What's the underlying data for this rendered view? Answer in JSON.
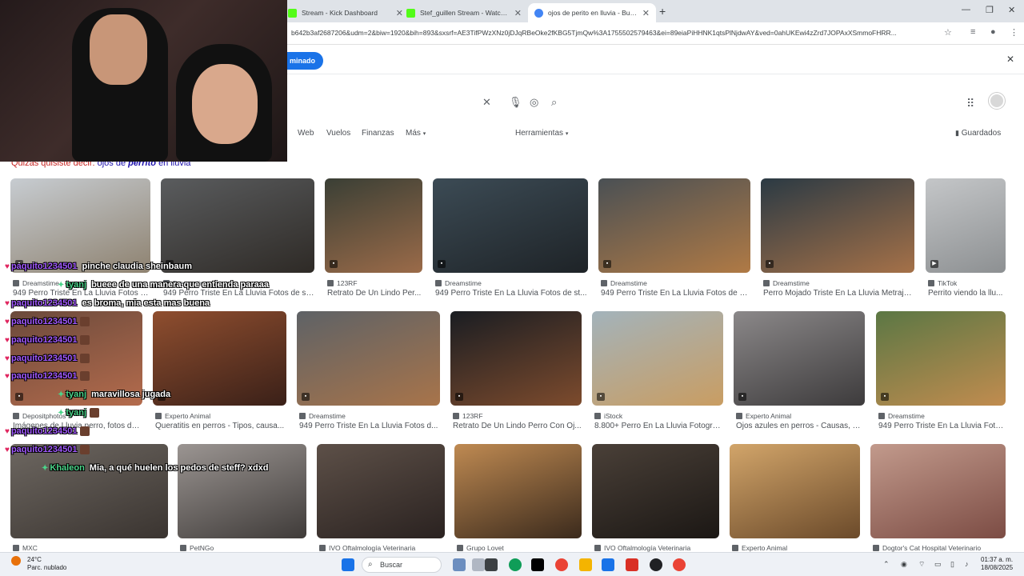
{
  "browser": {
    "tabs": [
      {
        "label": "Stream - Kick Dashboard",
        "color": "#53fc18"
      },
      {
        "label": "Stef_guillen Stream - Watch Li",
        "color": "#53fc18"
      },
      {
        "label": "ojos de perito en lluvia - Busca",
        "color": "#4285f4"
      }
    ],
    "new_tab": "+",
    "url": "b642b3af2687206&udm=2&biw=1920&bih=893&sxsrf=AE3TifPWzXNz0jDJqRBeOke2fKBG5TjmQw%3A1755502579463&ei=89eiaPiHHNK1qtsPlNjdwAY&ved=0ahUKEwi4zZrd7JOPAxXSmmoFHRR...",
    "infobar_pill": "minado"
  },
  "google": {
    "nav_tabs": [
      "Web",
      "Vuelos",
      "Finanzas",
      "Más",
      "Herramientas"
    ],
    "saved_label": "Guardados",
    "did_you_mean": {
      "prefix": "Quizás quisiste decir:",
      "pre": "ojos de",
      "bold": "perrito",
      "post": "en lluvia"
    }
  },
  "results_row1": [
    {
      "source": "Dreamstime",
      "title": "949 Perro Triste En La Lluvia Fotos d...",
      "colors": [
        "#c7ccd1",
        "#8e8270"
      ]
    },
    {
      "source": "Dreamstime",
      "title": "949 Perro Triste En La Lluvia Fotos de st...",
      "colors": [
        "#5a5c5e",
        "#2e2a26"
      ]
    },
    {
      "source": "123RF",
      "title": "Retrato De Un Lindo Per...",
      "colors": [
        "#3a3f35",
        "#9b6b49"
      ]
    },
    {
      "source": "Dreamstime",
      "title": "949 Perro Triste En La Lluvia Fotos de st...",
      "colors": [
        "#3c4b55",
        "#1e2327"
      ]
    },
    {
      "source": "Dreamstime",
      "title": "949 Perro Triste En La Lluvia Fotos de st...",
      "colors": [
        "#4a5054",
        "#b07a45"
      ]
    },
    {
      "source": "Dreamstime",
      "title": "Perro Mojado Triste En La Lluvia Metraje...",
      "colors": [
        "#2b3a44",
        "#a57148"
      ]
    },
    {
      "source": "TikTok",
      "title": "Perrito viendo la llu...",
      "colors": [
        "#c4c6c8",
        "#8d9092"
      ]
    }
  ],
  "results_row2": [
    {
      "source": "Depositphotos",
      "title": "Imágenes de Lluvia perro, fotos de...",
      "colors": [
        "#6b4a3c",
        "#b46b4c"
      ]
    },
    {
      "source": "Experto Animal",
      "title": "Queratitis en perros - Tipos, causa...",
      "colors": [
        "#8f4e2f",
        "#3a2018"
      ]
    },
    {
      "source": "Dreamstime",
      "title": "949 Perro Triste En La Lluvia Fotos d...",
      "colors": [
        "#5e6266",
        "#a8744a"
      ]
    },
    {
      "source": "123RF",
      "title": "Retrato De Un Lindo Perro Con Oj...",
      "colors": [
        "#1a1d22",
        "#7d4b2d"
      ]
    },
    {
      "source": "iStock",
      "title": "8.800+ Perro En La Lluvia Fotogra...",
      "colors": [
        "#a3b3bb",
        "#c99d62"
      ]
    },
    {
      "source": "Experto Animal",
      "title": "Ojos azules en perros - Causas, Tr...",
      "colors": [
        "#8b8889",
        "#3d3b3c"
      ]
    },
    {
      "source": "Dreamstime",
      "title": "949 Perro Triste En La Lluvia Foto...",
      "colors": [
        "#5b7744",
        "#c18c4f"
      ]
    }
  ],
  "results_row3": [
    {
      "source": "MXC",
      "colors": [
        "#6d6761",
        "#3a3430"
      ]
    },
    {
      "source": "PetNGo",
      "colors": [
        "#9b9592",
        "#3f3b39"
      ]
    },
    {
      "source": "IVO Oftalmología Veterinaria",
      "colors": [
        "#5d5048",
        "#2a2220"
      ]
    },
    {
      "source": "Grupo Lovet",
      "colors": [
        "#bf8a52",
        "#3b2a1c"
      ]
    },
    {
      "source": "IVO Oftalmología Veterinaria",
      "colors": [
        "#4a4038",
        "#1b1714"
      ]
    },
    {
      "source": "Experto Animal",
      "colors": [
        "#d2a56a",
        "#6b4a2a"
      ]
    },
    {
      "source": "Dogtor's Cat Hospital Veterinario",
      "colors": [
        "#c29a8c",
        "#7c4c44"
      ]
    }
  ],
  "chat": [
    {
      "user": "paquito1234501",
      "msg": "pinche claudia sheinbaum",
      "style": "user"
    },
    {
      "user": "tyanj",
      "msg": "bueee de una manera que entienda paraaa",
      "style": "user2"
    },
    {
      "user": "paquito1234501",
      "msg": "es broma, mia esta mas buena",
      "style": "user"
    },
    {
      "user": "paquito1234501",
      "msg": "",
      "style": "user"
    },
    {
      "user": "paquito1234501",
      "msg": "",
      "style": "user"
    },
    {
      "user": "paquito1234501",
      "msg": "",
      "style": "user"
    },
    {
      "user": "paquito1234501",
      "msg": "",
      "style": "user"
    },
    {
      "user": "tyanj",
      "msg": "maravillosa jugada",
      "style": "user2"
    },
    {
      "user": "tyanj",
      "msg": "",
      "style": "user2"
    },
    {
      "user": "paquito1234501",
      "msg": "",
      "style": "user"
    },
    {
      "user": "paquito1234501",
      "msg": "",
      "style": "user"
    },
    {
      "user": "Khaleon",
      "msg": "Mia, a qué huelen los pedos de steff? xdxd",
      "style": "user2"
    }
  ],
  "taskbar": {
    "weather_temp": "24°C",
    "weather_desc": "Parc. nublado",
    "search_label": "Buscar",
    "time": "01:37 a. m.",
    "date": "18/08/2025"
  }
}
